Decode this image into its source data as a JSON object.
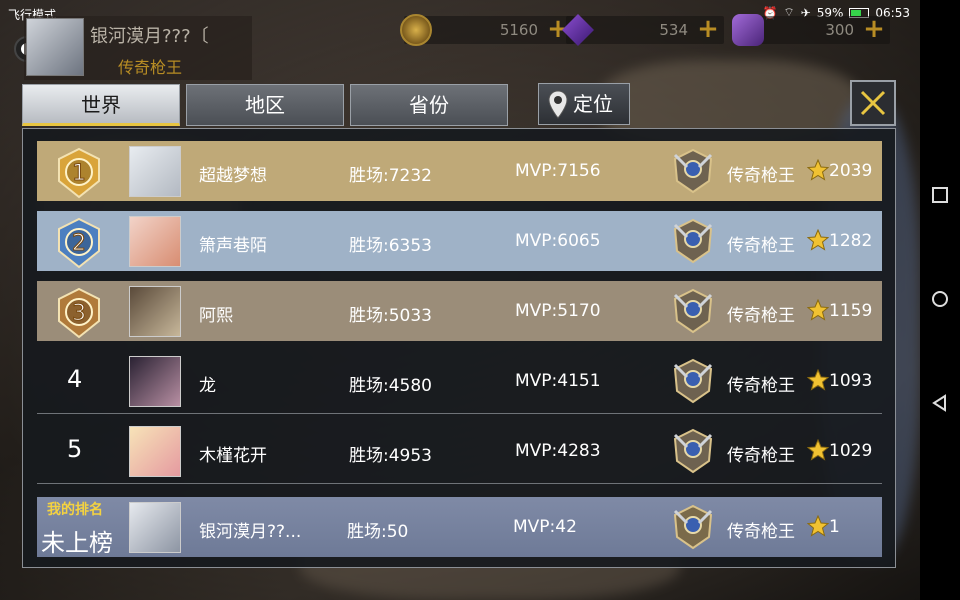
{
  "status_bar": {
    "mode": "飞行模式",
    "battery": "59%",
    "battery_level": 0.59,
    "time": "06:53"
  },
  "hud": {
    "player_name": "银河漠月???〔",
    "player_rank": "传奇枪王",
    "currencies": [
      {
        "icon": "gold-coin-icon",
        "value": "5160"
      },
      {
        "icon": "purple-diamond-icon",
        "value": "534"
      },
      {
        "icon": "purple-voucher-icon",
        "value": "300"
      }
    ]
  },
  "tabs": [
    {
      "label": "世界",
      "active": true
    },
    {
      "label": "地区",
      "active": false
    },
    {
      "label": "省份",
      "active": false
    }
  ],
  "locate_label": "定位",
  "leaderboard": [
    {
      "rank": "1",
      "name": "超越梦想",
      "wins": "胜场:7232",
      "mvp": "MVP:7156",
      "rank_title": "传奇枪王",
      "stars": "2039",
      "bg": "#bfa978"
    },
    {
      "rank": "2",
      "name": "箫声巷陌",
      "wins": "胜场:6353",
      "mvp": "MVP:6065",
      "rank_title": "传奇枪王",
      "stars": "1282",
      "bg": "#9fb2c7"
    },
    {
      "rank": "3",
      "name": "阿熙",
      "wins": "胜场:5033",
      "mvp": "MVP:5170",
      "rank_title": "传奇枪王",
      "stars": "1159",
      "bg": "#9b8d79"
    },
    {
      "rank": "4",
      "name": "龙",
      "wins": "胜场:4580",
      "mvp": "MVP:4151",
      "rank_title": "传奇枪王",
      "stars": "1093",
      "bg": "transparent"
    },
    {
      "rank": "5",
      "name": "木槿花开",
      "wins": "胜场:4953",
      "mvp": "MVP:4283",
      "rank_title": "传奇枪王",
      "stars": "1029",
      "bg": "transparent"
    }
  ],
  "my_rank": {
    "label": "我的排名",
    "status": "未上榜",
    "name": "银河漠月??...",
    "wins": "胜场:50",
    "mvp": "MVP:42",
    "rank_title": "传奇枪王",
    "stars": "1"
  },
  "colors": {
    "gold_accent": "#e8c541",
    "star": "#f1c232",
    "rank_gold": "#b88d24"
  }
}
